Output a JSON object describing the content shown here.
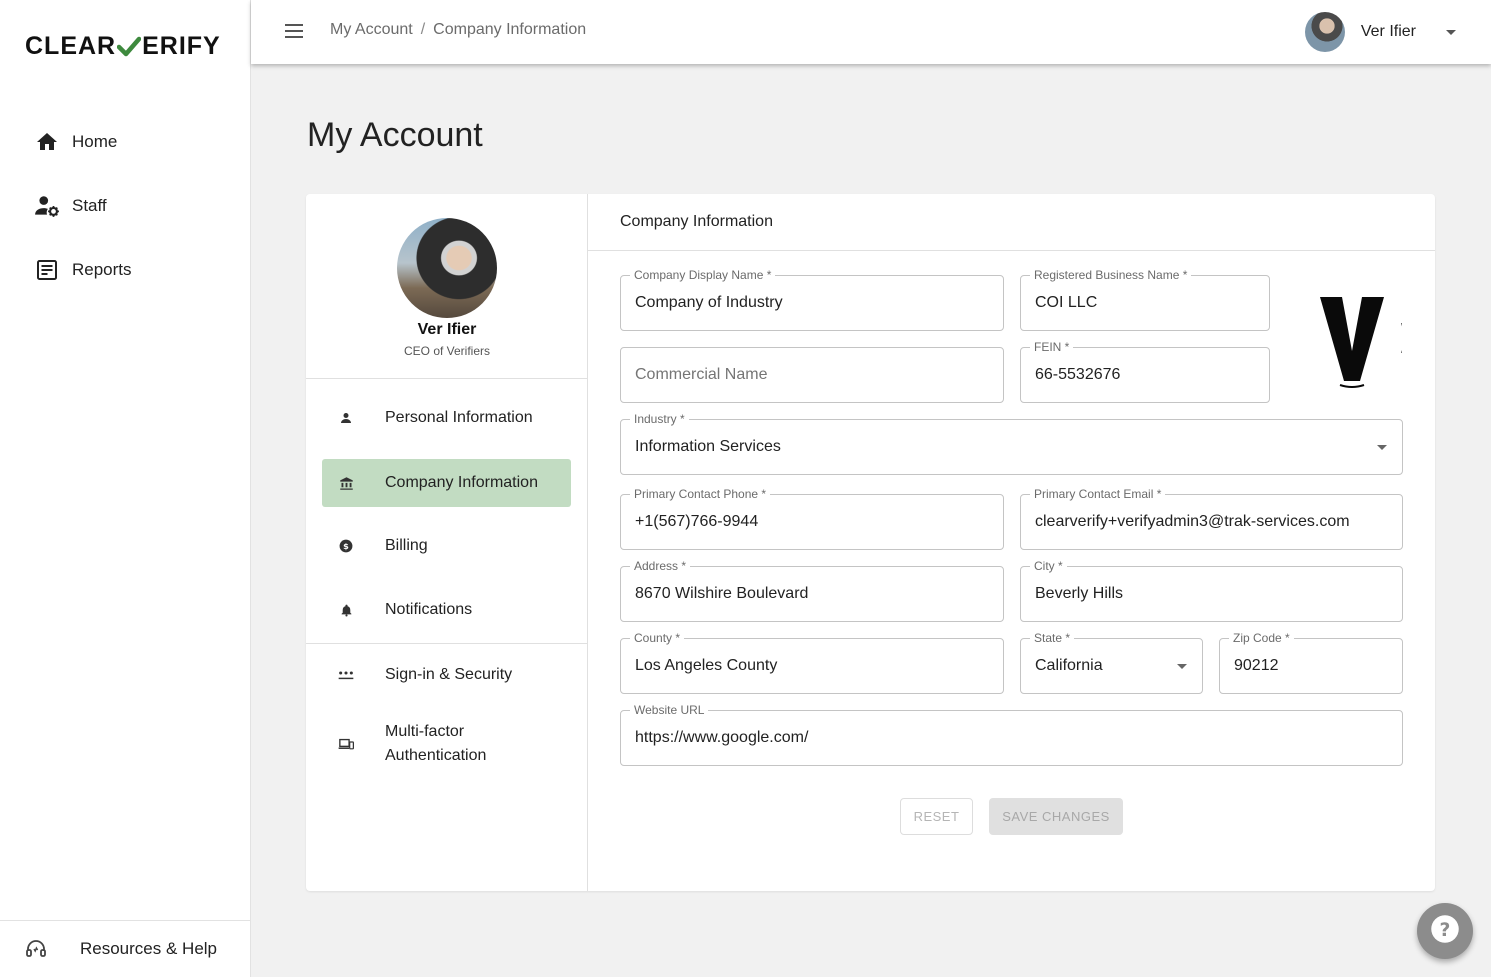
{
  "brand": {
    "logo_left": "CLEAR",
    "logo_right": "ERIFY"
  },
  "sidebar": {
    "items": [
      {
        "label": "Home",
        "icon": "home-icon"
      },
      {
        "label": "Staff",
        "icon": "staff-icon"
      },
      {
        "label": "Reports",
        "icon": "reports-icon"
      }
    ],
    "footer": {
      "label": "Resources & Help",
      "icon": "headset-icon"
    }
  },
  "topbar": {
    "breadcrumb": [
      "My Account",
      "/",
      "Company Information"
    ],
    "user_name": "Ver Ifier"
  },
  "page": {
    "title": "My Account"
  },
  "profile": {
    "name": "Ver Ifier",
    "role": "CEO of Verifiers"
  },
  "account_menu": [
    {
      "label": "Personal Information",
      "icon": "person-icon",
      "active": false
    },
    {
      "label": "Company Information",
      "icon": "bank-icon",
      "active": true
    },
    {
      "label": "Billing",
      "icon": "dollar-icon",
      "active": false
    },
    {
      "label": "Notifications",
      "icon": "bell-icon",
      "active": false
    },
    {
      "label": "Sign-in & Security",
      "icon": "password-icon",
      "active": false
    },
    {
      "label": "Multi-factor",
      "label2": "Authentication",
      "icon": "devices-icon",
      "active": false
    }
  ],
  "form": {
    "section_title": "Company Information",
    "company_display_name": {
      "label": "Company Display Name *",
      "value": "Company of Industry"
    },
    "registered_business_name": {
      "label": "Registered Business Name *",
      "value": "COI LLC"
    },
    "commercial_name": {
      "placeholder": "Commercial Name"
    },
    "fein": {
      "label": "FEIN *",
      "value": "66-5532676"
    },
    "industry": {
      "label": "Industry *",
      "value": "Information Services"
    },
    "primary_contact_phone": {
      "label": "Primary Contact Phone *",
      "value": "+1(567)766-9944"
    },
    "primary_contact_email": {
      "label": "Primary Contact Email *",
      "value": "clearverify+verifyadmin3@trak-services.com"
    },
    "address": {
      "label": "Address *",
      "value": "8670 Wilshire Boulevard"
    },
    "city": {
      "label": "City *",
      "value": "Beverly Hills"
    },
    "county": {
      "label": "County *",
      "value": "Los Angeles County"
    },
    "state": {
      "label": "State *",
      "value": "California"
    },
    "zip_code": {
      "label": "Zip Code *",
      "value": "90212"
    },
    "website_url": {
      "label": "Website URL",
      "value": "https://www.google.com/"
    },
    "reset_label": "RESET",
    "save_label": "SAVE CHANGES"
  },
  "colors": {
    "active_menu": "#c2dcc2",
    "brand_check": "#3e8a3e",
    "fab": "#8c8c8c"
  }
}
